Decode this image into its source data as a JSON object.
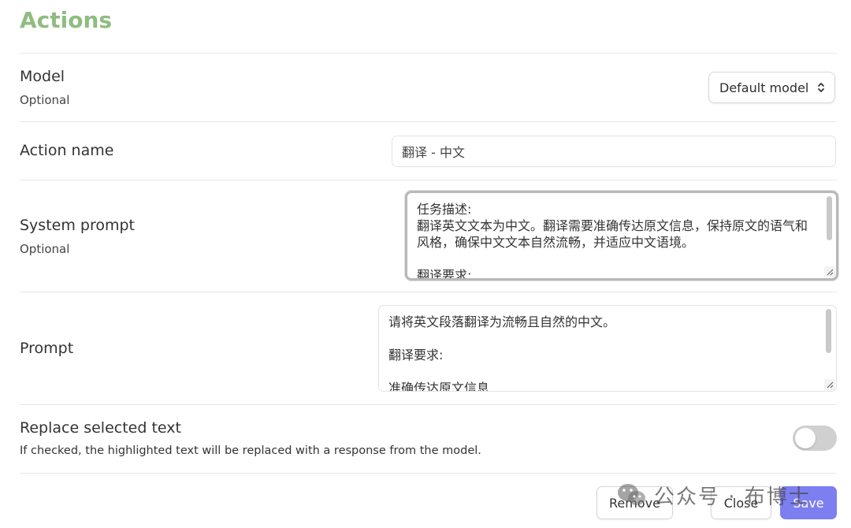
{
  "title": "Actions",
  "model": {
    "label": "Model",
    "sublabel": "Optional",
    "selected": "Default model"
  },
  "action_name": {
    "label": "Action name",
    "value": "翻译 - 中文"
  },
  "system_prompt": {
    "label": "System prompt",
    "sublabel": "Optional",
    "value": "任务描述:\n翻译英文文本为中文。翻译需要准确传达原文信息，保持原文的语气和风格，确保中文文本自然流畅，并适应中文语境。\n\n翻译要求:"
  },
  "prompt": {
    "label": "Prompt",
    "value": "请将英文段落翻译为流畅且自然的中文。\n\n翻译要求:\n\n准确传达原文信息"
  },
  "replace": {
    "label": "Replace selected text",
    "description": "If checked, the highlighted text will be replaced with a response from the model.",
    "checked": false
  },
  "buttons": {
    "remove": "Remove",
    "close": "Close",
    "save": "Save"
  },
  "watermark": "公众号 · 布博士",
  "icons": {
    "select_chevron": "chevron-up-down-icon",
    "resize": "resize-grip-icon",
    "watermark": "wechat-icon"
  },
  "colors": {
    "title": "#8fbc80",
    "primary": "#7b7ff0",
    "toggle_off": "#d0d0d0"
  }
}
